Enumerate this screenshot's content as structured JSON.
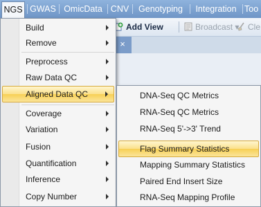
{
  "menubar": {
    "items": [
      "NGS",
      "GWAS",
      "OmicData",
      "CNV",
      "Genotyping",
      "Integration",
      "Too"
    ]
  },
  "toolbar": {
    "add_view": "Add View",
    "broadcast": "Broadcast",
    "clear": "Cle"
  },
  "panel": {
    "close_glyph": "×"
  },
  "menu": {
    "items": [
      {
        "label": "Build",
        "submenu": true
      },
      {
        "label": "Remove",
        "submenu": true
      },
      {
        "label": "Preprocess",
        "submenu": true
      },
      {
        "label": "Raw Data QC",
        "submenu": true
      },
      {
        "label": "Aligned Data QC",
        "submenu": true,
        "highlighted": true
      },
      {
        "label": "Coverage",
        "submenu": true
      },
      {
        "label": "Variation",
        "submenu": true
      },
      {
        "label": "Fusion",
        "submenu": true
      },
      {
        "label": "Quantification",
        "submenu": true
      },
      {
        "label": "Inference",
        "submenu": true
      },
      {
        "label": "Copy Number",
        "submenu": true
      }
    ]
  },
  "submenu": {
    "items": [
      {
        "label": "DNA-Seq QC Metrics"
      },
      {
        "label": "RNA-Seq QC Metrics"
      },
      {
        "label": "RNA-Seq 5'->3' Trend"
      },
      {
        "label": "Flag Summary Statistics",
        "highlighted": true
      },
      {
        "label": "Mapping Summary Statistics"
      },
      {
        "label": "Paired End Insert Size"
      },
      {
        "label": "RNA-Seq Mapping Profile"
      }
    ]
  },
  "colors": {
    "menubar": "#7fa3d2",
    "highlight": "#fbe08b",
    "menu_bg": "#f5f5f5"
  }
}
